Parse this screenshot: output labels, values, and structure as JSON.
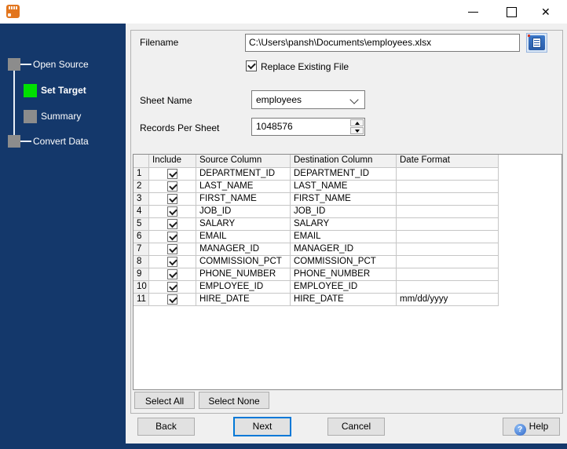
{
  "window": {
    "controls": {
      "minimize": "minimize",
      "maximize": "maximize",
      "close": "close"
    },
    "close_glyph": "✕"
  },
  "sidebar": {
    "steps": [
      {
        "label": "Open Source",
        "state": "done"
      },
      {
        "label": "Set Target",
        "state": "active"
      },
      {
        "label": "Summary",
        "state": "pending"
      },
      {
        "label": "Convert Data",
        "state": "pending"
      }
    ]
  },
  "form": {
    "filename_label": "Filename",
    "filename_value": "C:\\Users\\pansh\\Documents\\employees.xlsx",
    "replace_checkbox_label": "Replace Existing File",
    "replace_checked": true,
    "sheet_name_label": "Sheet Name",
    "sheet_name_value": "employees",
    "records_label": "Records Per Sheet",
    "records_value": "1048576"
  },
  "grid": {
    "headers": [
      "",
      "Include",
      "Source Column",
      "Destination Column",
      "Date Format"
    ],
    "rows": [
      {
        "num": "1",
        "included": true,
        "source": "DEPARTMENT_ID",
        "destination": "DEPARTMENT_ID",
        "date_format": ""
      },
      {
        "num": "2",
        "included": true,
        "source": "LAST_NAME",
        "destination": "LAST_NAME",
        "date_format": ""
      },
      {
        "num": "3",
        "included": true,
        "source": "FIRST_NAME",
        "destination": "FIRST_NAME",
        "date_format": ""
      },
      {
        "num": "4",
        "included": true,
        "source": "JOB_ID",
        "destination": "JOB_ID",
        "date_format": ""
      },
      {
        "num": "5",
        "included": true,
        "source": "SALARY",
        "destination": "SALARY",
        "date_format": ""
      },
      {
        "num": "6",
        "included": true,
        "source": "EMAIL",
        "destination": "EMAIL",
        "date_format": ""
      },
      {
        "num": "7",
        "included": true,
        "source": "MANAGER_ID",
        "destination": "MANAGER_ID",
        "date_format": ""
      },
      {
        "num": "8",
        "included": true,
        "source": "COMMISSION_PCT",
        "destination": "COMMISSION_PCT",
        "date_format": ""
      },
      {
        "num": "9",
        "included": true,
        "source": "PHONE_NUMBER",
        "destination": "PHONE_NUMBER",
        "date_format": ""
      },
      {
        "num": "10",
        "included": true,
        "source": "EMPLOYEE_ID",
        "destination": "EMPLOYEE_ID",
        "date_format": ""
      },
      {
        "num": "11",
        "included": true,
        "source": "HIRE_DATE",
        "destination": "HIRE_DATE",
        "date_format": "mm/dd/yyyy"
      }
    ]
  },
  "buttons": {
    "select_all": "Select All",
    "select_none": "Select None",
    "back": "Back",
    "next": "Next",
    "cancel": "Cancel",
    "help": "Help"
  },
  "colors": {
    "sidebar_navy": "#14386b",
    "active_step_green": "#00e100",
    "step_gray": "#8c8c8c",
    "accent_blue": "#0078d7",
    "app_icon_orange": "#e2751d"
  }
}
